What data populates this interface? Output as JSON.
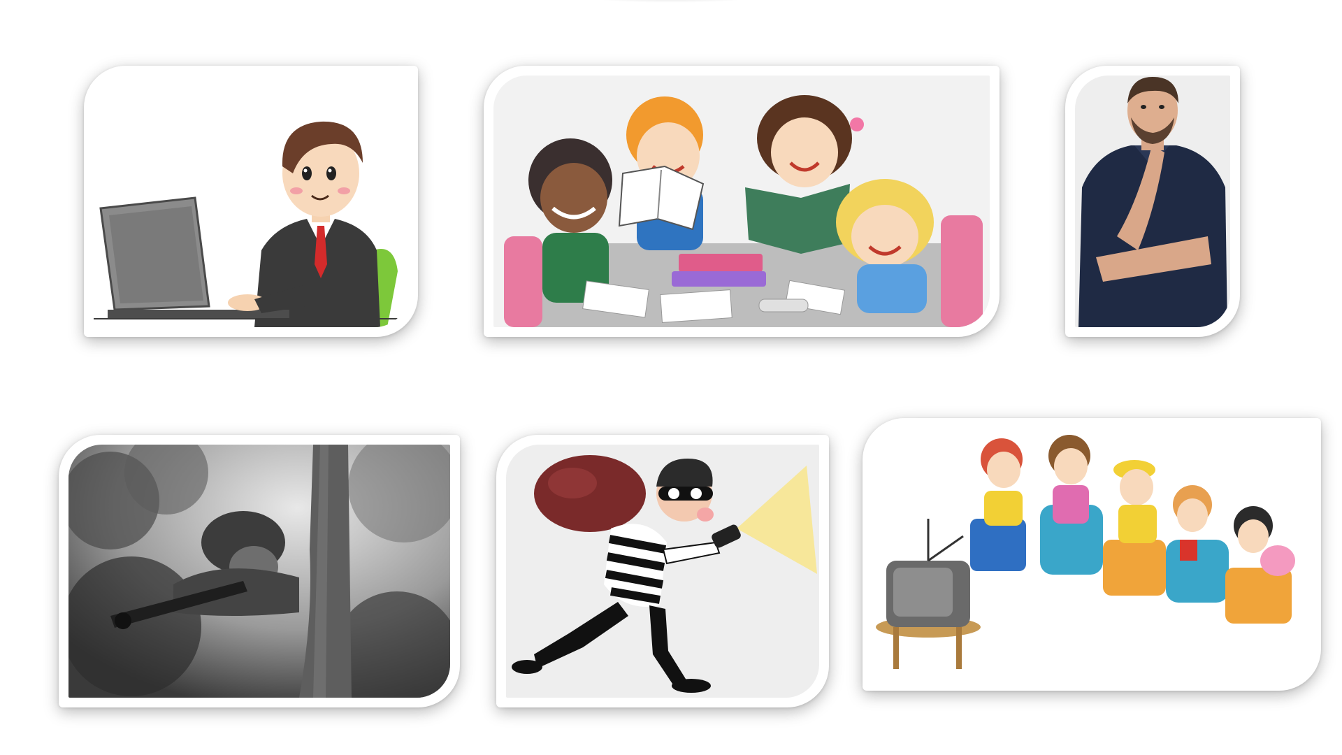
{
  "slide": {
    "background": "#ffffff",
    "frame_color": "#ffffff"
  },
  "images": [
    {
      "icon": "man-working-on-laptop-icon"
    },
    {
      "icon": "children-studying-together-icon"
    },
    {
      "icon": "man-thinking-icon"
    },
    {
      "icon": "sniper-hiding-in-forest-icon"
    },
    {
      "icon": "burglar-with-flashlight-icon"
    },
    {
      "icon": "children-watching-tv-icon"
    }
  ]
}
